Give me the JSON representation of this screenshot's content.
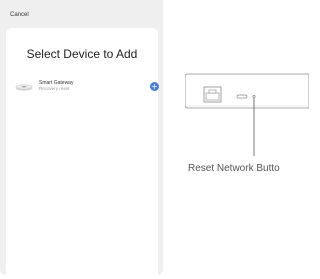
{
  "header": {
    "cancel_label": "Cancel"
  },
  "sheet": {
    "title": "Select Device to Add"
  },
  "device": {
    "name": "Smart Gateway",
    "subtitle": "Recovery reset",
    "icon": "gateway-icon",
    "add_icon": "plus-icon",
    "add_glyph": "+"
  },
  "illustration": {
    "label": "Reset Network Butto"
  },
  "colors": {
    "accent": "#4a7fd6",
    "background": "#efefef",
    "sheet": "#ffffff"
  }
}
